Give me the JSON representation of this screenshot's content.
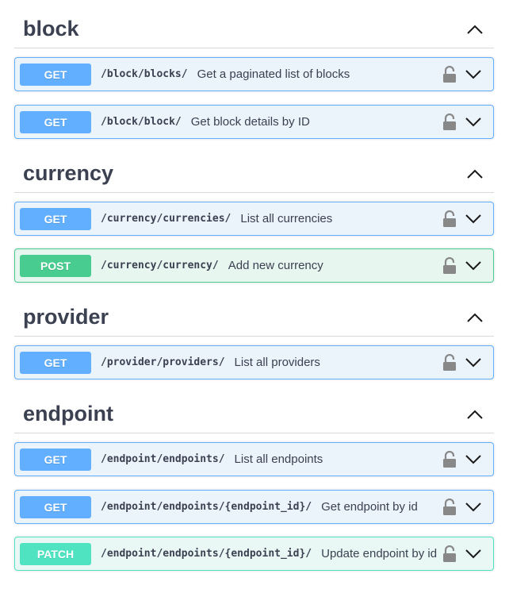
{
  "sections": [
    {
      "title": "block",
      "operations": [
        {
          "method": "GET",
          "path": "/block/blocks/",
          "summary": "Get a paginated list of blocks"
        },
        {
          "method": "GET",
          "path": "/block/block/",
          "summary": "Get block details by ID"
        }
      ]
    },
    {
      "title": "currency",
      "operations": [
        {
          "method": "GET",
          "path": "/currency/currencies/",
          "summary": "List all currencies"
        },
        {
          "method": "POST",
          "path": "/currency/currency/",
          "summary": "Add new currency"
        }
      ]
    },
    {
      "title": "provider",
      "operations": [
        {
          "method": "GET",
          "path": "/provider/providers/",
          "summary": "List all providers"
        }
      ]
    },
    {
      "title": "endpoint",
      "operations": [
        {
          "method": "GET",
          "path": "/endpoint/endpoints/",
          "summary": "List all endpoints"
        },
        {
          "method": "GET",
          "path": "/endpoint/endpoints/{endpoint_id}/",
          "summary": "Get endpoint by id"
        },
        {
          "method": "PATCH",
          "path": "/endpoint/endpoints/{endpoint_id}/",
          "summary": "Update endpoint by id"
        }
      ]
    }
  ],
  "icons": {
    "section_toggle": "chevron-up-icon",
    "lock": "lock-icon",
    "expand": "chevron-down-icon"
  },
  "colors": {
    "get": "#61affe",
    "post": "#49cc90",
    "patch": "#50e3c2",
    "text": "#3b4151"
  }
}
